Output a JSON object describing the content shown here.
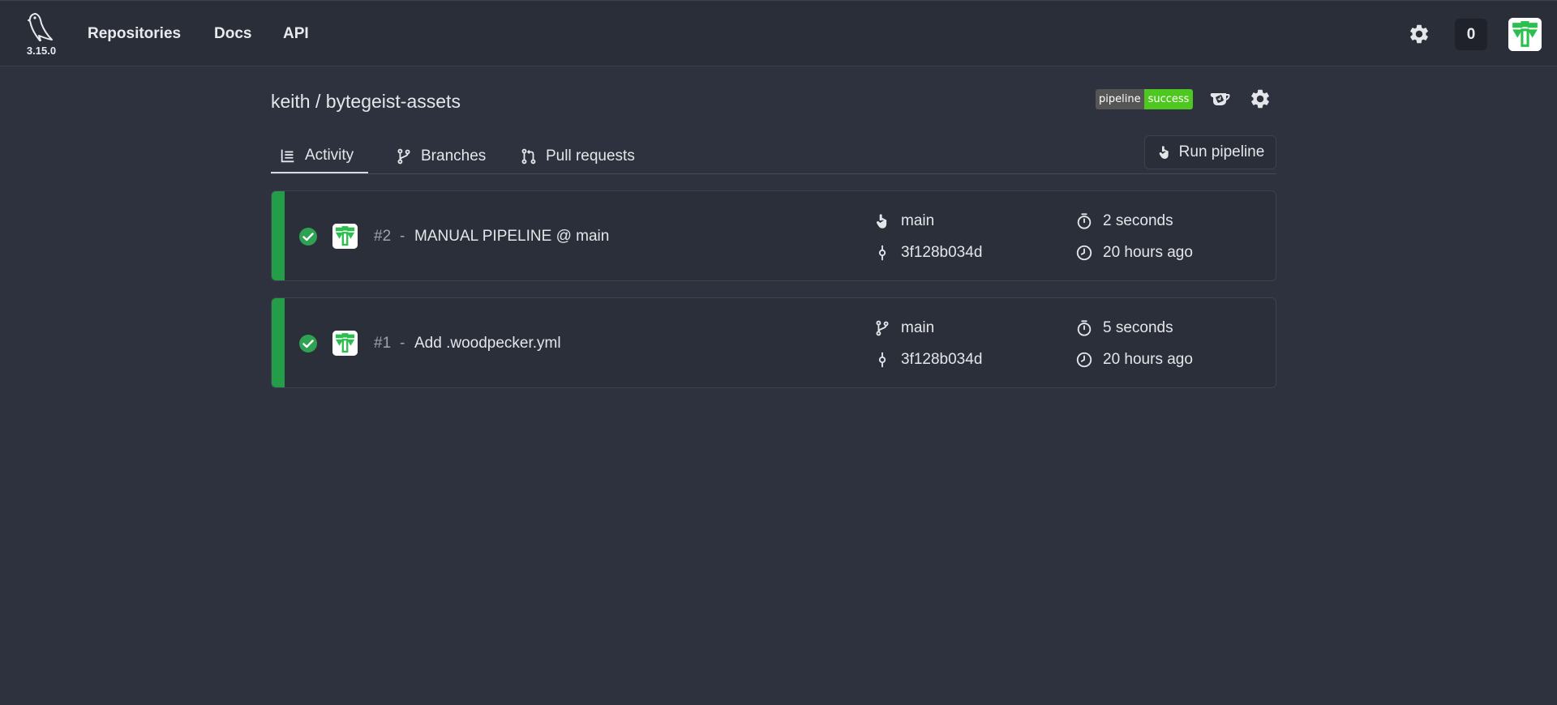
{
  "nav": {
    "version": "3.15.0",
    "links": [
      "Repositories",
      "Docs",
      "API"
    ],
    "counter": "0"
  },
  "repo": {
    "title": "keith / bytegeist-assets",
    "badge_label": "pipeline",
    "badge_status": "success"
  },
  "tabs": [
    {
      "label": "Activity",
      "icon": "activity-icon",
      "active": true
    },
    {
      "label": "Branches",
      "icon": "branch-icon",
      "active": false
    },
    {
      "label": "Pull requests",
      "icon": "pull-request-icon",
      "active": false
    }
  ],
  "run_pipeline_label": "Run pipeline",
  "pipelines": [
    {
      "number": "#2",
      "separator": "-",
      "message": "MANUAL PIPELINE @ main",
      "event_icon": "manual-trigger-icon",
      "branch": "main",
      "commit": "3f128b034d",
      "duration": "2 seconds",
      "created": "20 hours ago",
      "status": "success"
    },
    {
      "number": "#1",
      "separator": "-",
      "message": "Add .woodpecker.yml",
      "event_icon": "branch-icon",
      "branch": "main",
      "commit": "3f128b034d",
      "duration": "5 seconds",
      "created": "20 hours ago",
      "status": "success"
    }
  ],
  "colors": {
    "background": "#2e323e",
    "navbar": "#2a2e38",
    "success": "#249d48",
    "badge_green": "#4ec820"
  }
}
